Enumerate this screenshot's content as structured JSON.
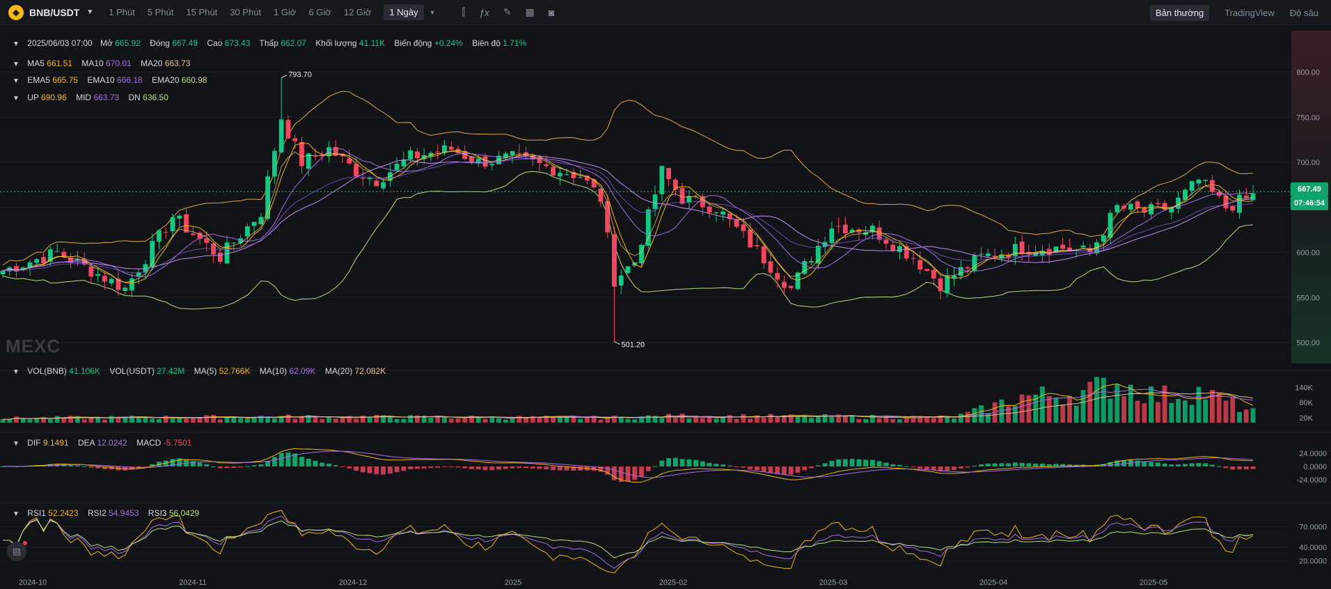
{
  "header": {
    "symbol": "BNB/USDT",
    "timeframes": [
      "1 Phút",
      "5 Phút",
      "15 Phút",
      "30 Phút",
      "1 Giờ",
      "6 Giờ",
      "12 Giờ",
      "1 Ngày"
    ],
    "active_timeframe": "1 Ngày",
    "views": [
      "Bản thường",
      "TradingView",
      "Độ sâu"
    ],
    "active_view": "Bản thường",
    "icons": [
      "candle-type-icon",
      "indicator-fx-icon",
      "draw-pencil-icon",
      "layout-grid-icon",
      "camera-icon"
    ]
  },
  "ohlc": {
    "date": "2025/06/03 07:00",
    "items": [
      {
        "label": "Mở",
        "value": "665.92"
      },
      {
        "label": "Đóng",
        "value": "667.49"
      },
      {
        "label": "Cao",
        "value": "673.43"
      },
      {
        "label": "Thấp",
        "value": "662.07"
      },
      {
        "label": "Khối lượng",
        "value": "41.11K"
      },
      {
        "label": "Biến động",
        "value": "+0.24%"
      },
      {
        "label": "Biên độ",
        "value": "1.71%"
      }
    ]
  },
  "ma": [
    {
      "label": "MA5",
      "value": "661.51"
    },
    {
      "label": "MA10",
      "value": "670.01"
    },
    {
      "label": "MA20",
      "value": "663.73"
    }
  ],
  "ema": [
    {
      "label": "EMA5",
      "value": "665.75"
    },
    {
      "label": "EMA10",
      "value": "666.18"
    },
    {
      "label": "EMA20",
      "value": "660.98"
    }
  ],
  "boll": [
    {
      "label": "UP",
      "value": "690.96"
    },
    {
      "label": "MID",
      "value": "663.73"
    },
    {
      "label": "DN",
      "value": "636.50"
    }
  ],
  "vol": [
    {
      "label": "VOL(BNB)",
      "value": "41.106K"
    },
    {
      "label": "VOL(USDT)",
      "value": "27.42M"
    },
    {
      "label": "MA(5)",
      "value": "52.766K"
    },
    {
      "label": "MA(10)",
      "value": "62.09K"
    },
    {
      "label": "MA(20)",
      "value": "72.082K"
    }
  ],
  "macd": [
    {
      "label": "DIF",
      "value": "9.1491"
    },
    {
      "label": "DEA",
      "value": "12.0242"
    },
    {
      "label": "MACD",
      "value": "-5.7501"
    }
  ],
  "rsi": [
    {
      "label": "RSI1",
      "value": "52.2423"
    },
    {
      "label": "RSI2",
      "value": "54.9453"
    },
    {
      "label": "RSI3",
      "value": "56.0429"
    }
  ],
  "last_price": "667.49",
  "countdown": "07:46:54",
  "watermark": "MEXC",
  "colors": {
    "up": "#0ecb81",
    "down": "#f6465d",
    "ma5": "#f0b90b",
    "ma10": "#a56ee8",
    "ma20": "#e3c08f",
    "bg": "#121317"
  },
  "chart_data": {
    "type": "candlestick",
    "start": "2024-09-24",
    "interval": "1 day",
    "x_ticks": [
      "2024-10",
      "2024-11",
      "2024-12",
      "2025",
      "2025-02",
      "2025-03",
      "2025-04",
      "2025-05"
    ],
    "price_ticks": [
      800,
      750,
      700,
      650,
      600,
      550,
      500
    ],
    "price_axis_labels": [
      "800.00",
      "750.00",
      "700.00",
      "650.00",
      "600.00",
      "550.00",
      "500.00"
    ],
    "price_range": [
      477,
      846
    ],
    "high_marker": "793.70",
    "low_marker": "501.20",
    "volume_ticks": [
      "140K",
      "80K",
      "20K"
    ],
    "volume_range": [
      0,
      180000
    ],
    "macd_ticks": [
      "24.0000",
      "0.0000",
      "-24.0000"
    ],
    "macd_range": [
      -43,
      43
    ],
    "rsi_ticks": [
      "70.0000",
      "40.0000",
      "20.0000"
    ],
    "rsi_range": [
      5,
      91
    ],
    "anchors": [
      {
        "day": 0,
        "price": 580
      },
      {
        "day": 8,
        "price": 600
      },
      {
        "day": 18,
        "price": 560
      },
      {
        "day": 25,
        "price": 640
      },
      {
        "day": 32,
        "price": 595
      },
      {
        "day": 38,
        "price": 645
      },
      {
        "day": 41,
        "price": 750
      },
      {
        "day": 44,
        "price": 700
      },
      {
        "day": 48,
        "price": 715
      },
      {
        "day": 52,
        "price": 690
      },
      {
        "day": 55,
        "price": 680
      },
      {
        "day": 60,
        "price": 706
      },
      {
        "day": 66,
        "price": 715
      },
      {
        "day": 70,
        "price": 700
      },
      {
        "day": 75,
        "price": 705
      },
      {
        "day": 79,
        "price": 697
      },
      {
        "day": 85,
        "price": 685
      },
      {
        "day": 88,
        "price": 660
      },
      {
        "day": 90,
        "price": 570
      },
      {
        "day": 93,
        "price": 590
      },
      {
        "day": 97,
        "price": 690
      },
      {
        "day": 100,
        "price": 660
      },
      {
        "day": 105,
        "price": 650
      },
      {
        "day": 110,
        "price": 610
      },
      {
        "day": 116,
        "price": 560
      },
      {
        "day": 118,
        "price": 585
      },
      {
        "day": 122,
        "price": 630
      },
      {
        "day": 128,
        "price": 625
      },
      {
        "day": 134,
        "price": 595
      },
      {
        "day": 138,
        "price": 565
      },
      {
        "day": 144,
        "price": 595
      },
      {
        "day": 150,
        "price": 605
      },
      {
        "day": 156,
        "price": 605
      },
      {
        "day": 160,
        "price": 600
      },
      {
        "day": 164,
        "price": 650
      },
      {
        "day": 168,
        "price": 645
      },
      {
        "day": 172,
        "price": 650
      },
      {
        "day": 176,
        "price": 680
      },
      {
        "day": 180,
        "price": 650
      },
      {
        "day": 184,
        "price": 663
      }
    ],
    "volume_anchors": [
      {
        "day": 0,
        "value": 18000
      },
      {
        "day": 40,
        "value": 25000
      },
      {
        "day": 88,
        "value": 20000
      },
      {
        "day": 100,
        "value": 28000
      },
      {
        "day": 140,
        "value": 22000
      },
      {
        "day": 145,
        "value": 60000
      },
      {
        "day": 150,
        "value": 110000
      },
      {
        "day": 158,
        "value": 120000
      },
      {
        "day": 164,
        "value": 165000
      },
      {
        "day": 170,
        "value": 110000
      },
      {
        "day": 176,
        "value": 130000
      },
      {
        "day": 184,
        "value": 45000
      }
    ]
  }
}
